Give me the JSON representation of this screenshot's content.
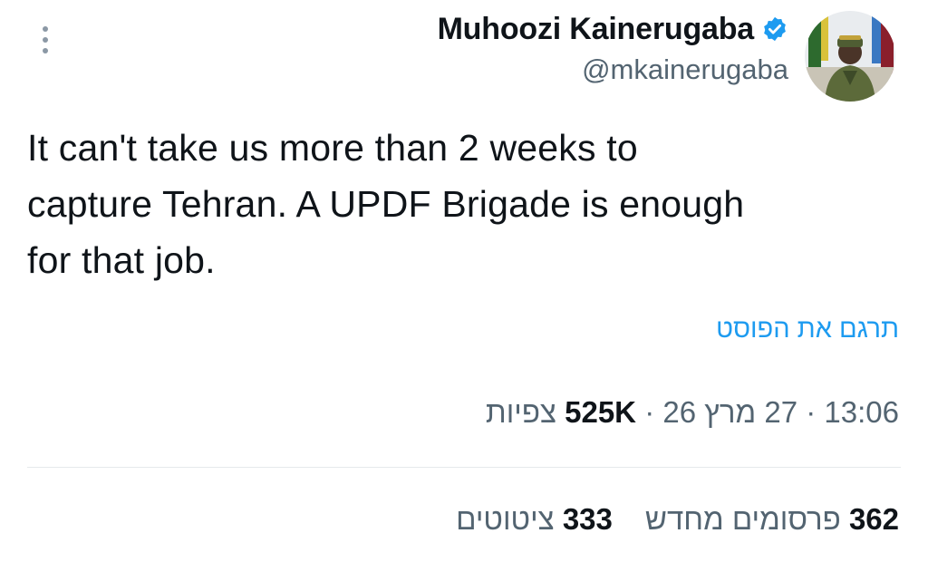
{
  "author": {
    "display_name": "Muhoozi Kainerugaba",
    "handle": "@mkainerugaba",
    "verified": true,
    "verified_color": "#1d9bf0"
  },
  "tweet": {
    "text": "It can't take us more than 2 weeks to\ncapture Tehran. A UPDF Brigade is enough\nfor that job."
  },
  "translate": {
    "label": "תרגם את הפוסט"
  },
  "meta": {
    "time": "13:06",
    "date": "27 מרץ 26",
    "separator": "·",
    "views_count": "525K",
    "views_label": "צפיות"
  },
  "stats": {
    "reposts_count": "362",
    "reposts_label": "פרסומים מחדש",
    "quotes_count": "333",
    "quotes_label": "ציטוטים"
  },
  "icons": {
    "more": "more-vertical-icon",
    "verified": "verified-badge-icon"
  },
  "colors": {
    "text": "#0f1419",
    "secondary": "#536471",
    "link": "#1d9bf0",
    "divider": "#e6e9eb"
  }
}
